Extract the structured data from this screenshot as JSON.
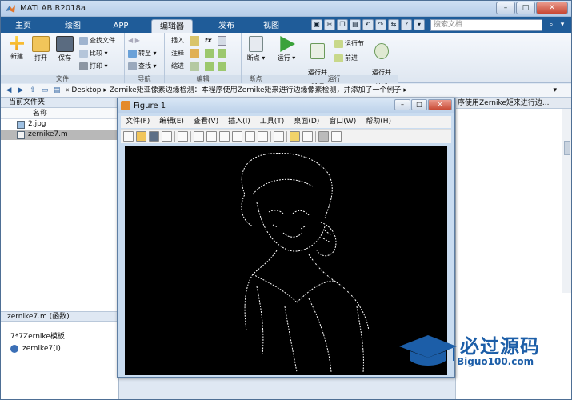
{
  "window": {
    "title": "MATLAB R2018a"
  },
  "tabs": [
    "主页",
    "绘图",
    "APP",
    "编辑器",
    "发布",
    "视图"
  ],
  "search": {
    "placeholder": "搜索文档"
  },
  "ribbon": {
    "file_group": {
      "label": "文件",
      "new": "新建",
      "open": "打开",
      "save": "保存",
      "find_files": "查找文件",
      "compare": "比较",
      "print": "打印"
    },
    "nav_group": {
      "label": "导航",
      "goto": "转至",
      "find": "查找"
    },
    "edit_group": {
      "label": "编辑",
      "insert": "插入",
      "comment": "注释",
      "indent": "缩进",
      "fx": "fx"
    },
    "breakpoint_group": {
      "label": "断点",
      "breakpoint": "断点"
    },
    "run_group": {
      "label": "运行",
      "run": "运行",
      "run_advance": "运行并\n前进",
      "run_section": "运行节",
      "advance": "前进",
      "run_time": "运行并\n计时"
    }
  },
  "address": {
    "path": "«  Desktop  ▸  Zernike矩亚像素边缘检测：本程序使用Zernike矩来进行边缘像素检测，并添加了一个例子  ▸"
  },
  "left_panel": {
    "title": "当前文件夹",
    "column": "名称",
    "files": [
      "2.jpg",
      "zernike7.m"
    ],
    "details_title": "zernike7.m  (函数)",
    "detail_desc": "7*7Zernike模板",
    "detail_func": "zernike7(I)"
  },
  "right_editor": {
    "tab_text": "序使用Zernike矩来进行边..."
  },
  "figure": {
    "title": "Figure 1",
    "menu": [
      "文件(F)",
      "编辑(E)",
      "查看(V)",
      "插入(I)",
      "工具(T)",
      "桌面(D)",
      "窗口(W)",
      "帮助(H)"
    ]
  },
  "watermark": {
    "brand": "必过源码",
    "site": "Biguo100.com"
  },
  "colors": {
    "tabstrip": "#1f5c99",
    "canvas": "#000000",
    "brand": "#1c5ea8"
  }
}
